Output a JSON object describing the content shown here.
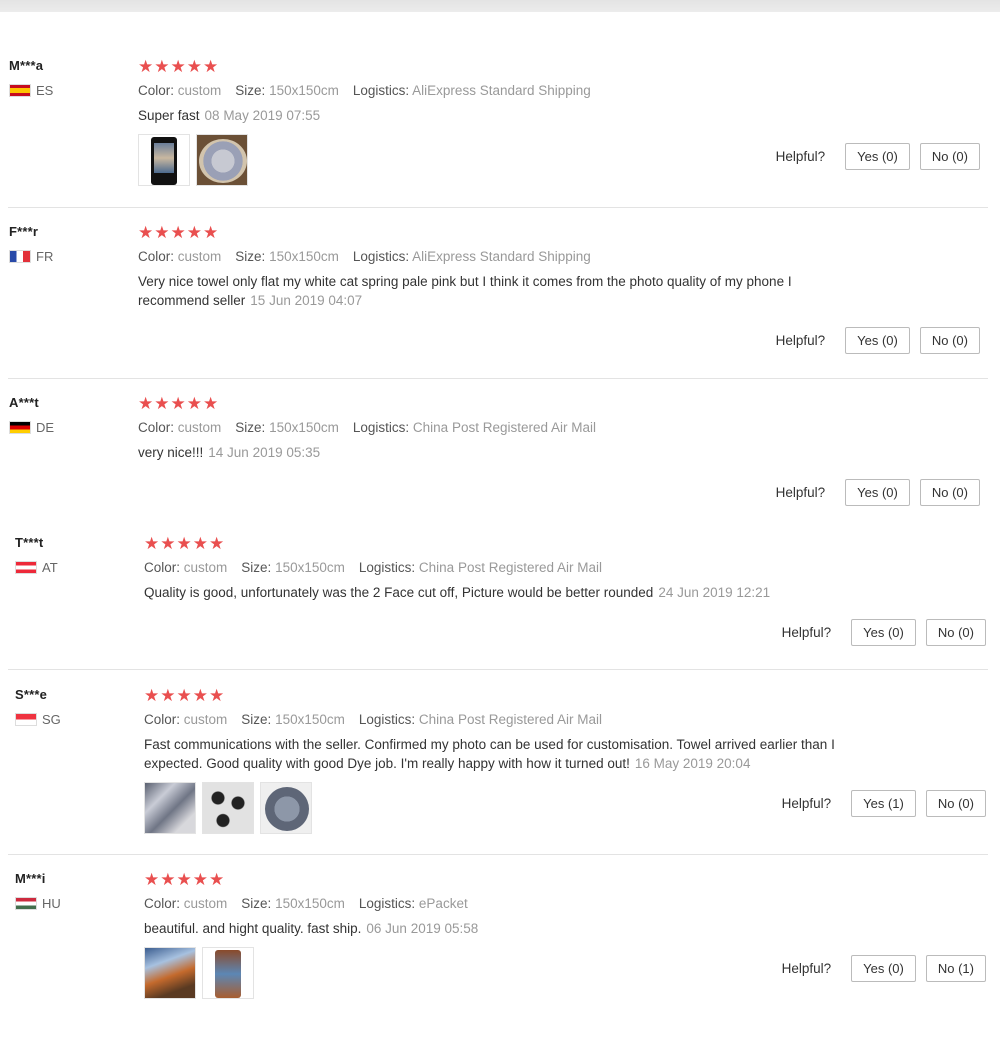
{
  "labels": {
    "color": "Color:",
    "size": "Size:",
    "logistics": "Logistics:",
    "helpful": "Helpful?"
  },
  "reviews": [
    {
      "user": "M***a",
      "country": "ES",
      "stars": "★★★★★",
      "color": "custom",
      "size": "150x150cm",
      "logistics": "AliExpress Standard Shipping",
      "text": "Super fast",
      "date": "08 May 2019 07:55",
      "yes": "Yes (0)",
      "no": "No (0)",
      "photos": [
        "phone-screen-photo",
        "round-towel-photo"
      ]
    },
    {
      "user": "F***r",
      "country": "FR",
      "stars": "★★★★★",
      "color": "custom",
      "size": "150x150cm",
      "logistics": "AliExpress Standard Shipping",
      "text": "Very nice towel only flat my white cat spring pale pink but I think it comes from the photo quality of my phone I recommend seller",
      "date": "15 Jun 2019 04:07",
      "yes": "Yes (0)",
      "no": "No (0)"
    },
    {
      "user": "A***t",
      "country": "DE",
      "stars": "★★★★★",
      "color": "custom",
      "size": "150x150cm",
      "logistics": "China Post Registered Air Mail",
      "text": "very nice!!!",
      "date": "14 Jun 2019 05:35",
      "yes": "Yes (0)",
      "no": "No (0)"
    },
    {
      "user": "T***t",
      "country": "AT",
      "stars": "★★★★★",
      "color": "custom",
      "size": "150x150cm",
      "logistics": "China Post Registered Air Mail",
      "text": "Quality is good, unfortunately was the 2 Face cut off, Picture would be better rounded",
      "date": "24 Jun 2019 12:21",
      "yes": "Yes (0)",
      "no": "No (0)"
    },
    {
      "user": "S***e",
      "country": "SG",
      "stars": "★★★★★",
      "color": "custom",
      "size": "150x150cm",
      "logistics": "China Post Registered Air Mail",
      "text": "Fast communications with the seller. Confirmed my photo can be used for customisation. Towel arrived earlier than I expected. Good quality with good Dye job. I'm really happy with how it turned out!",
      "date": "16 May 2019 20:04",
      "yes": "Yes (1)",
      "no": "No (0)",
      "photos": [
        "folded-towel-photo",
        "dotted-towel-photo",
        "round-towel-photo"
      ]
    },
    {
      "user": "M***i",
      "country": "HU",
      "stars": "★★★★★",
      "color": "custom",
      "size": "150x150cm",
      "logistics": "ePacket",
      "text": "beautiful. and hight quality. fast ship.",
      "date": "06 Jun 2019 05:58",
      "yes": "Yes (0)",
      "no": "No (1)",
      "photos": [
        "painted-towel-photo",
        "phone-photo"
      ]
    }
  ],
  "colors": {
    "star": "#e94f4f",
    "muted": "#999999",
    "divider": "#e3e3e3"
  }
}
